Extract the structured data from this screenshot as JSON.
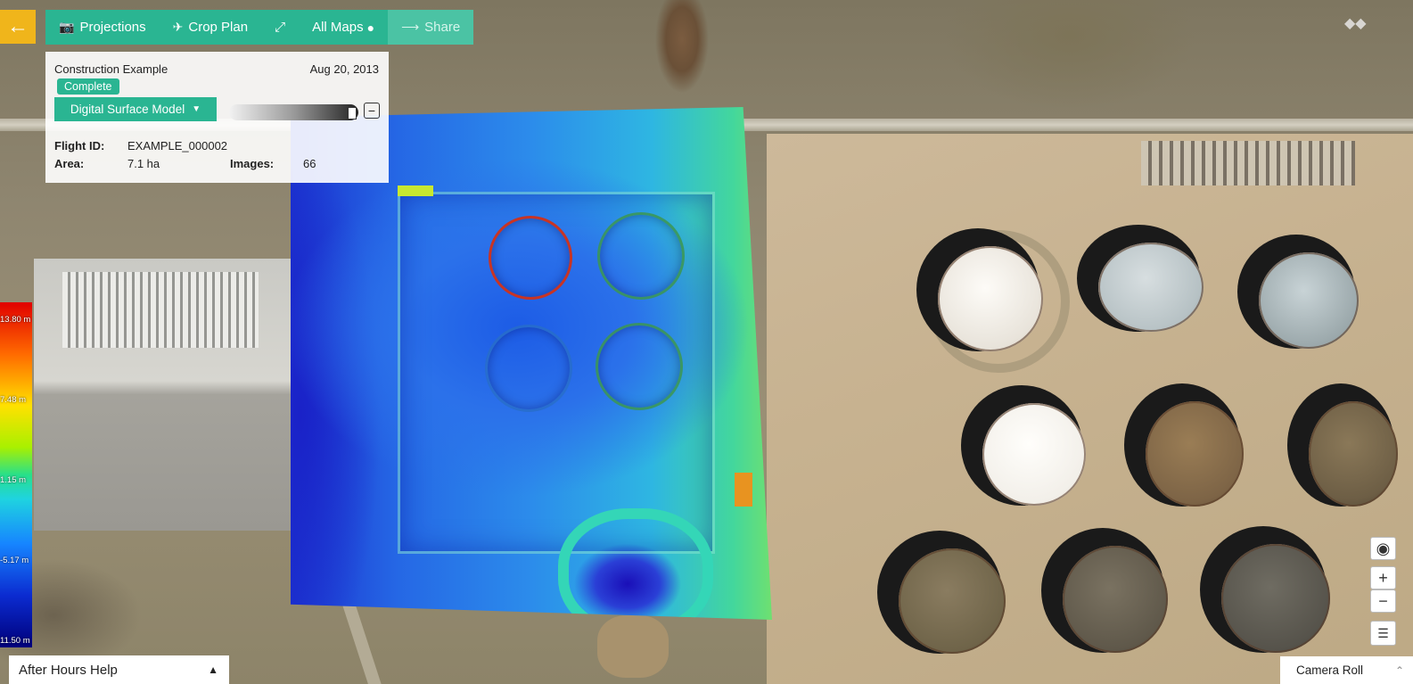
{
  "toolbar": {
    "back_icon": "arrow-left-icon",
    "projections_label": "Projections",
    "crop_plan_label": "Crop Plan",
    "all_maps_label": "All Maps",
    "share_label": "Share"
  },
  "flight": {
    "project_name": "Construction Example",
    "date": "Aug 20, 2013",
    "status": "Complete",
    "layer_select": "Digital Surface Model",
    "flight_id_label": "Flight ID:",
    "flight_id": "EXAMPLE_000002",
    "area_label": "Area:",
    "area": "7.1 ha",
    "images_label": "Images:",
    "images": "66"
  },
  "legend": {
    "max": "13.80 m",
    "v2": "7.48 m",
    "v3": "1.15 m",
    "v4": "-5.17 m",
    "min": "11.50 m"
  },
  "map_controls": {
    "eye": "◉",
    "zoom_in": "+",
    "zoom_out": "−"
  },
  "help": {
    "label": "After Hours Help"
  },
  "camera_roll": {
    "label": "Camera Roll"
  },
  "colors": {
    "accent": "#2ab592",
    "back_button": "#f0b51b"
  }
}
